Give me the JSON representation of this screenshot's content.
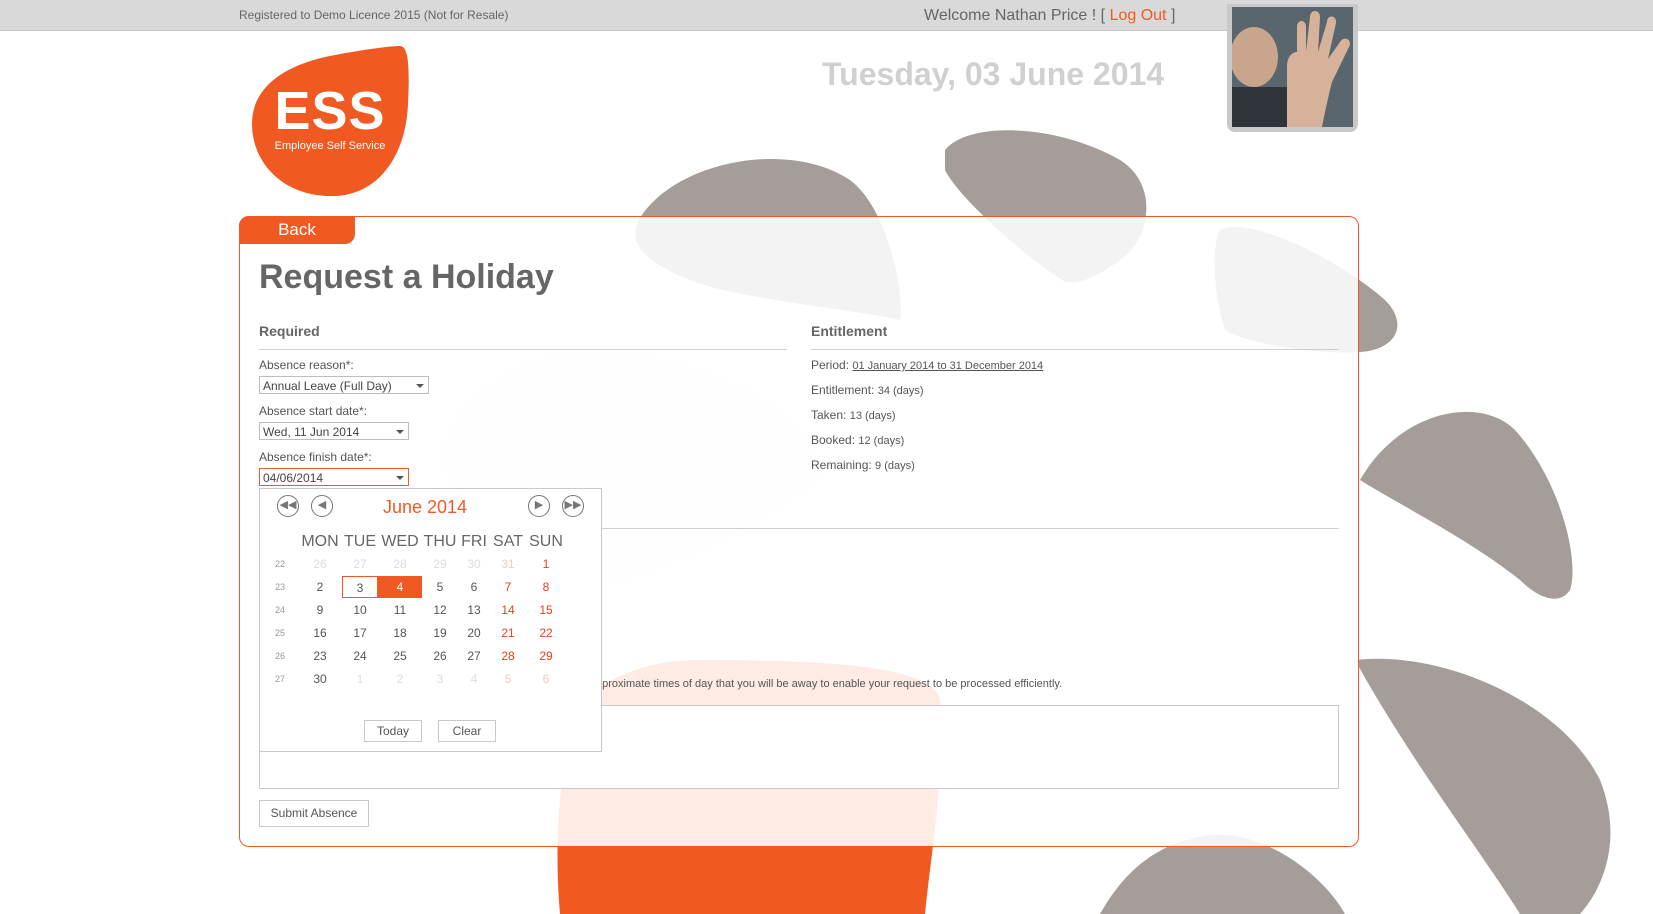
{
  "topbar": {
    "licence": "Registered to Demo Licence 2015 (Not for Resale)",
    "welcome_prefix": "Welcome Nathan Price ! [",
    "logout_label": "Log Out",
    "welcome_suffix": "]"
  },
  "header": {
    "date": "Tuesday, 03 June 2014"
  },
  "logo": {
    "main": "ESS",
    "sub": "Employee Self Service"
  },
  "nav": {
    "back_label": "Back"
  },
  "page": {
    "title": "Request a Holiday"
  },
  "required": {
    "heading": "Required",
    "absence_reason_label": "Absence reason*:",
    "absence_reason_value": "Annual Leave (Full Day)",
    "start_date_label": "Absence start date*:",
    "start_date_value": "Wed, 11 Jun 2014",
    "finish_date_label": "Absence finish date*:",
    "finish_date_value": "04/06/2014"
  },
  "entitlement": {
    "heading": "Entitlement",
    "period_label": "Period:",
    "period_value": "01 January 2014 to 31 December 2014",
    "entitlement_label": "Entitlement:",
    "entitlement_value": "34 (days)",
    "taken_label": "Taken:",
    "taken_value": "13 (days)",
    "booked_label": "Booked:",
    "booked_value": "12 (days)",
    "remaining_label": "Remaining:",
    "remaining_value": "9 (days)"
  },
  "notes": {
    "text": "pproximate times of day that you will be away to enable your request to be processed efficiently."
  },
  "actions": {
    "submit_label": "Submit Absence"
  },
  "calendar": {
    "title": "June 2014",
    "nav_icons": [
      "first-page-icon",
      "prev-page-icon",
      "next-page-icon",
      "last-page-icon"
    ],
    "weekdays": [
      "MON",
      "TUE",
      "WED",
      "THU",
      "FRI",
      "SAT",
      "SUN"
    ],
    "weeks": [
      {
        "num": "22",
        "days": [
          "26",
          "27",
          "28",
          "29",
          "30",
          "31",
          "1"
        ],
        "other": [
          true,
          true,
          true,
          true,
          true,
          true,
          false
        ]
      },
      {
        "num": "23",
        "days": [
          "2",
          "3",
          "4",
          "5",
          "6",
          "7",
          "8"
        ],
        "other": [
          false,
          false,
          false,
          false,
          false,
          false,
          false
        ]
      },
      {
        "num": "24",
        "days": [
          "9",
          "10",
          "11",
          "12",
          "13",
          "14",
          "15"
        ],
        "other": [
          false,
          false,
          false,
          false,
          false,
          false,
          false
        ]
      },
      {
        "num": "25",
        "days": [
          "16",
          "17",
          "18",
          "19",
          "20",
          "21",
          "22"
        ],
        "other": [
          false,
          false,
          false,
          false,
          false,
          false,
          false
        ]
      },
      {
        "num": "26",
        "days": [
          "23",
          "24",
          "25",
          "26",
          "27",
          "28",
          "29"
        ],
        "other": [
          false,
          false,
          false,
          false,
          false,
          false,
          false
        ]
      },
      {
        "num": "27",
        "days": [
          "30",
          "1",
          "2",
          "3",
          "4",
          "5",
          "6"
        ],
        "other": [
          false,
          true,
          true,
          true,
          true,
          true,
          true
        ]
      }
    ],
    "today": "3",
    "selected": "4",
    "today_label": "Today",
    "clear_label": "Clear"
  },
  "colors": {
    "accent": "#f05a22",
    "shape_grey": "#a49d99",
    "shape_light": "#f1f1f1"
  }
}
